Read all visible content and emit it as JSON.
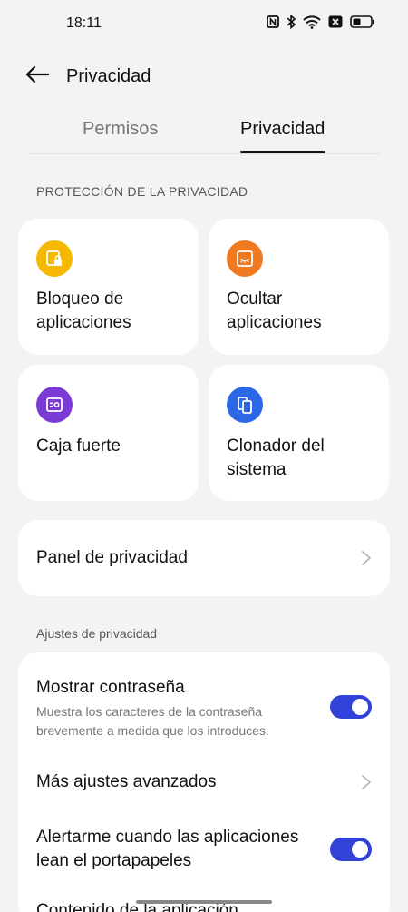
{
  "status_bar": {
    "time": "18:11",
    "icons": [
      "nfc-icon",
      "bluetooth-icon",
      "wifi-icon",
      "sim-blocked-icon",
      "battery-icon"
    ],
    "battery_level": 0.4
  },
  "header": {
    "back_icon": "arrow-left-icon",
    "title": "Privacidad"
  },
  "tabs": [
    {
      "label": "Permisos",
      "active": false
    },
    {
      "label": "Privacidad",
      "active": true
    }
  ],
  "protection": {
    "section_title": "PROTECCIÓN DE LA PRIVACIDAD",
    "tiles": [
      {
        "label": "Bloqueo de aplicaciones",
        "icon": "app-lock-icon",
        "color": "#f5b800"
      },
      {
        "label": "Ocultar aplicaciones",
        "icon": "hide-apps-icon",
        "color": "#f07a22"
      },
      {
        "label": "Caja fuerte",
        "icon": "safe-icon",
        "color": "#7b3ad6"
      },
      {
        "label": "Clonador del sistema",
        "icon": "system-cloner-icon",
        "color": "#2c67e6"
      }
    ]
  },
  "privacy_panel": {
    "label": "Panel de privacidad"
  },
  "settings": {
    "section_title": "Ajustes de privacidad",
    "items": [
      {
        "title": "Mostrar contraseña",
        "subtitle": "Muestra los caracteres de la contraseña brevemente a medida que los introduces.",
        "toggle_on": true
      },
      {
        "title": "Más ajustes avanzados"
      },
      {
        "title": "Alertarme cuando las aplicaciones lean el portapapeles",
        "toggle_on": true
      },
      {
        "title": "Contenido de la aplicación"
      }
    ]
  },
  "colors": {
    "accent": "#3042d8",
    "background": "#f3f3f3",
    "card": "#ffffff"
  }
}
